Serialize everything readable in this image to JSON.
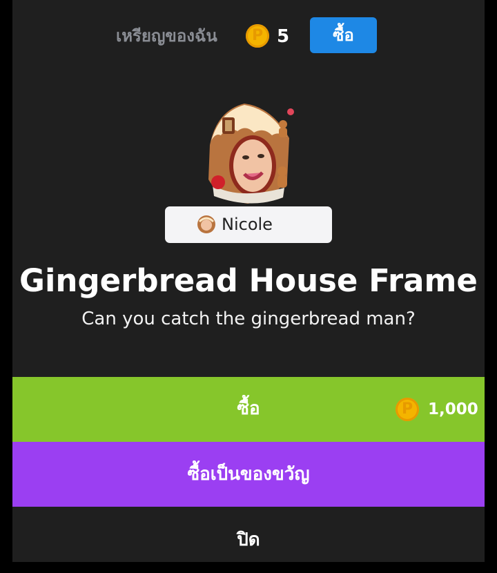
{
  "header": {
    "coins_label": "เหรียญของฉัน",
    "coin_symbol": "P",
    "coin_count": "5",
    "buy_label": "ซื้อ"
  },
  "item": {
    "owner_name": "Nicole",
    "title": "Gingerbread House Frame",
    "description": "Can you catch the gingerbread man?"
  },
  "actions": {
    "buy_label": "ซื้อ",
    "price": "1,000",
    "gift_label": "ซื้อเป็นของขวัญ",
    "close_label": "ปิด"
  },
  "colors": {
    "buy_green": "#86c62b",
    "gift_purple": "#9b3ff2",
    "header_buy_blue": "#1e88e5",
    "coin_gold": "#f4b400"
  }
}
